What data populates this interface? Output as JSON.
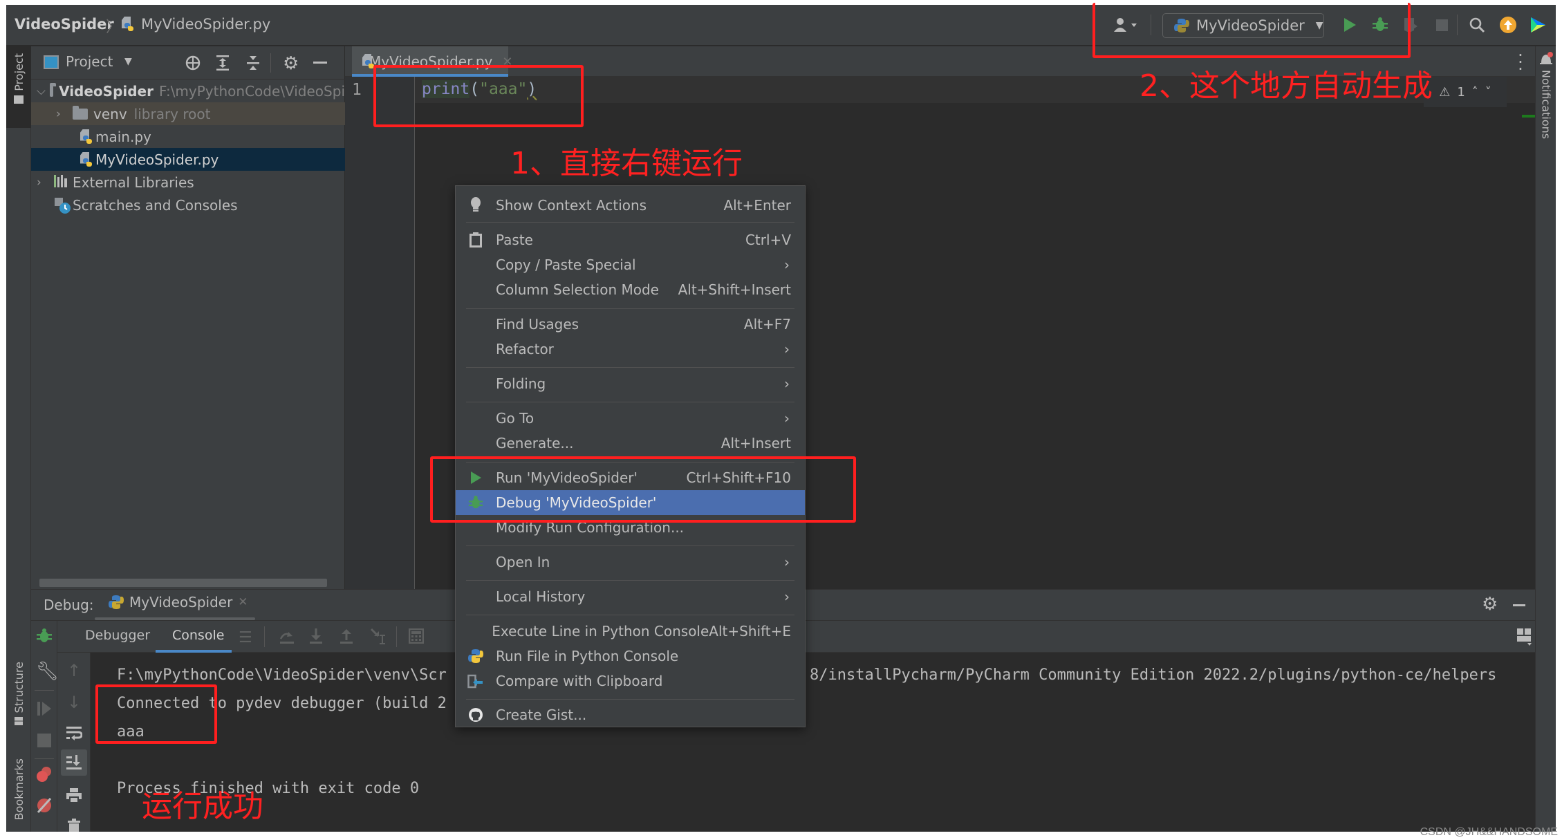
{
  "navbar": {
    "project_name": "VideoSpider",
    "file_name": "MyVideoSpider.py",
    "run_config": "MyVideoSpider",
    "icons": [
      "user-icon",
      "run-icon",
      "debug-icon",
      "coverage-icon",
      "stop-icon",
      "search-icon",
      "update-icon",
      "jetbrains-icon"
    ]
  },
  "left_stripe": {
    "project_label": "Project",
    "structure_label": "Structure",
    "bookmarks_label": "Bookmarks"
  },
  "right_stripe": {
    "notifications_label": "Notifications"
  },
  "project_panel": {
    "title": "Project",
    "tree": [
      {
        "label": "VideoSpider",
        "hint": "F:\\myPythonCode\\VideoSpi",
        "type": "folder",
        "expanded": true
      },
      {
        "label": "venv",
        "hint": "library root",
        "type": "folder",
        "expanded": false
      },
      {
        "label": "main.py",
        "hint": "",
        "type": "python-file"
      },
      {
        "label": "MyVideoSpider.py",
        "hint": "",
        "type": "python-file",
        "selected": true
      },
      {
        "label": "External Libraries",
        "hint": "",
        "type": "libraries",
        "expanded": false
      },
      {
        "label": "Scratches and Consoles",
        "hint": "",
        "type": "scratches"
      }
    ]
  },
  "editor": {
    "tab_label": "MyVideoSpider.py",
    "line_number": "1",
    "code": {
      "func": "print",
      "open": "(",
      "string": "\"aaa\"",
      "close": ")"
    },
    "warnings_count": "1"
  },
  "context_menu": {
    "items": [
      {
        "label": "Show Context Actions",
        "shortcut": "Alt+Enter",
        "icon": "bulb-icon"
      },
      {
        "label": "Paste",
        "shortcut": "Ctrl+V",
        "icon": "clipboard-icon"
      },
      {
        "label": "Copy / Paste Special",
        "submenu": true
      },
      {
        "label": "Column Selection Mode",
        "shortcut": "Alt+Shift+Insert"
      },
      {
        "label": "Find Usages",
        "shortcut": "Alt+F7"
      },
      {
        "label": "Refactor",
        "submenu": true
      },
      {
        "label": "Folding",
        "submenu": true
      },
      {
        "label": "Go To",
        "submenu": true
      },
      {
        "label": "Generate...",
        "shortcut": "Alt+Insert"
      },
      {
        "label": "Run 'MyVideoSpider'",
        "shortcut": "Ctrl+Shift+F10",
        "icon": "run-icon"
      },
      {
        "label": "Debug 'MyVideoSpider'",
        "shortcut": "",
        "icon": "debug-icon",
        "selected": true
      },
      {
        "label": "Modify Run Configuration...",
        "shortcut": ""
      },
      {
        "label": "Open In",
        "submenu": true
      },
      {
        "label": "Local History",
        "submenu": true
      },
      {
        "label": "Execute Line in Python Console",
        "shortcut": "Alt+Shift+E"
      },
      {
        "label": "Run File in Python Console",
        "icon": "python-icon"
      },
      {
        "label": "Compare with Clipboard",
        "icon": "compare-icon"
      },
      {
        "label": "Create Gist...",
        "icon": "github-icon"
      }
    ]
  },
  "debug_panel": {
    "label": "Debug:",
    "session_tab": "MyVideoSpider",
    "tabs": [
      "Debugger",
      "Console"
    ],
    "active_tab": "Console",
    "console_lines": [
      "F:\\myPythonCode\\VideoSpider\\venv\\Scr",
      "Connected to pydev debugger (build 2",
      "aaa",
      "",
      "Process finished with exit code 0"
    ],
    "console_line_tail": "8/installPycharm/PyCharm Community Edition 2022.2/plugins/python-ce/helpers"
  },
  "annotations": {
    "step1": "1、直接右键运行",
    "step2": "2、这个地方自动生成",
    "success": "运行成功"
  },
  "watermark": "CSDN @JH&&HANDSOME",
  "colors": {
    "accent_blue": "#4a88c7",
    "selection": "#4b6eaf",
    "run_green": "#499c54",
    "annotation_red": "#ff1f1f",
    "keyword_purple": "#8888c6",
    "string_green": "#6a8759"
  }
}
